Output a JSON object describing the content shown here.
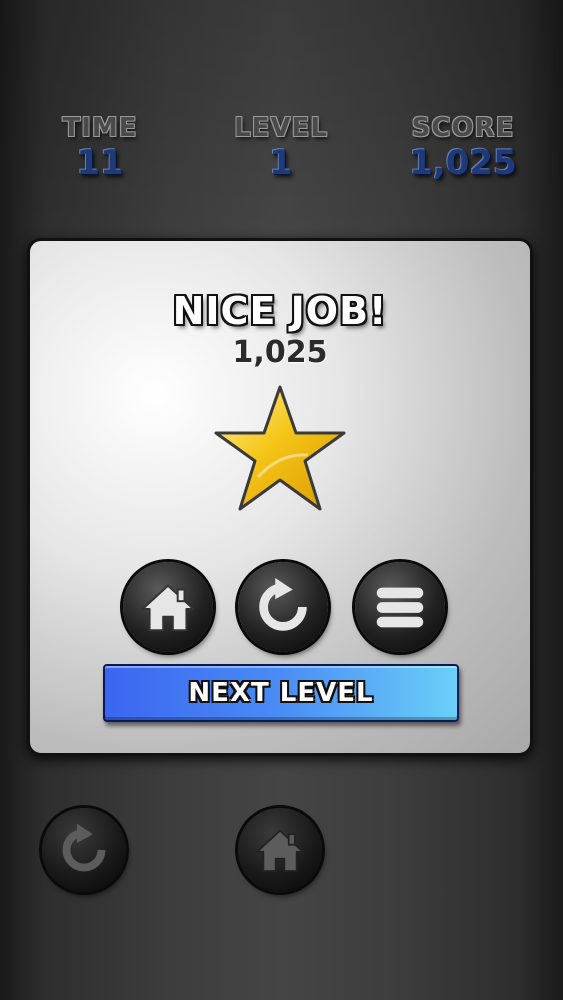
{
  "hud": {
    "time": {
      "label": "TIME",
      "value": "11"
    },
    "level": {
      "label": "LEVEL",
      "value": "1"
    },
    "score": {
      "label": "SCORE",
      "value": "1,025"
    }
  },
  "dialog": {
    "title": "NICE JOB!",
    "score": "1,025",
    "stars_earned": 1,
    "actions": [
      {
        "name": "home",
        "icon": "home-icon"
      },
      {
        "name": "replay",
        "icon": "replay-icon"
      },
      {
        "name": "menu",
        "icon": "menu-icon"
      }
    ],
    "next_label": "NEXT LEVEL"
  },
  "bottom_bar": {
    "buttons": [
      {
        "name": "replay",
        "icon": "replay-icon"
      },
      {
        "name": "home",
        "icon": "home-icon"
      }
    ]
  },
  "colors": {
    "star": "#f5c518",
    "next_button": "#3b66f0",
    "hud_value": "#1f3a78"
  }
}
